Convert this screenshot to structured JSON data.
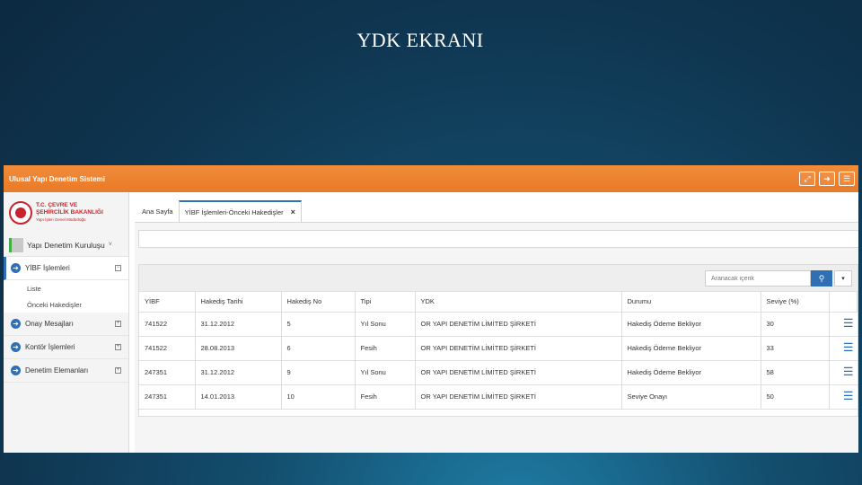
{
  "slide_title": "YDK EKRANI",
  "app": {
    "title": "Ulusal Yapı Denetim Sistemi",
    "header_icons": [
      "fullscreen-icon",
      "logout-icon",
      "menu-icon"
    ]
  },
  "sidebar": {
    "logo": {
      "line1": "T.C. ÇEVRE VE",
      "line2": "ŞEHİRCİLİK BAKANLIĞI",
      "line3": "Yapı İşleri Genel Müdürlüğü"
    },
    "org_name": "Yapı Denetim Kuruluşu",
    "menu": [
      {
        "label": "YİBF İşlemleri",
        "expand": "⊟",
        "active": true
      },
      {
        "label": "Onay Mesajları",
        "expand": "⊞"
      },
      {
        "label": "Kontör İşlemleri",
        "expand": "⊞"
      },
      {
        "label": "Denetim Elemanları",
        "expand": "⊞"
      }
    ],
    "submenu": [
      "Liste",
      "Önceki Hakedişler"
    ]
  },
  "tabs": [
    {
      "label": "Ana Sayfa"
    },
    {
      "label": "YİBF İşlemleri-Önceki Hakedişler",
      "close": "×"
    }
  ],
  "search": {
    "placeholder": "Aranacak içerik"
  },
  "table": {
    "columns": [
      "YİBF",
      "Hakediş Tarihi",
      "Hakediş No",
      "Tipi",
      "YDK",
      "Durumu",
      "Seviye (%)",
      ""
    ],
    "rows": [
      [
        "741522",
        "31.12.2012",
        "5",
        "Yıl Sonu",
        "OR YAPI DENETİM LİMİTED ŞİRKETİ",
        "Hakediş Ödeme Bekliyor",
        "30"
      ],
      [
        "741522",
        "28.08.2013",
        "6",
        "Fesih",
        "OR YAPI DENETİM LİMİTED ŞİRKETİ",
        "Hakediş Ödeme Bekliyor",
        "33"
      ],
      [
        "247351",
        "31.12.2012",
        "9",
        "Yıl Sonu",
        "OR YAPI DENETİM LİMİTED ŞİRKETİ",
        "Hakediş Ödeme Bekliyor",
        "58"
      ],
      [
        "247351",
        "14.01.2013",
        "10",
        "Fesih",
        "OR YAPI DENETİM LİMİTED ŞİRKETİ",
        "Seviye Onayı",
        "50"
      ]
    ]
  },
  "colors": {
    "header": "#ef8533",
    "accent": "#2f6fb3",
    "logo": "#c8232c"
  }
}
